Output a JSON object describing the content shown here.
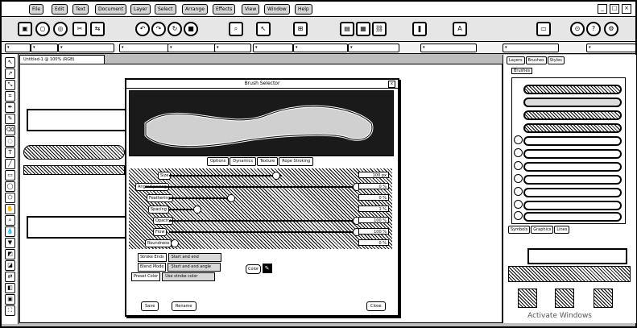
{
  "menubar": {
    "items": [
      "File",
      "Edit",
      "Text",
      "Document",
      "Layer",
      "Select",
      "Arrange",
      "Effects",
      "View",
      "Window",
      "Help"
    ]
  },
  "dialog": {
    "title": "Brush Selector",
    "close": "x",
    "tabs": [
      "Options",
      "Dynamics",
      "Texture",
      "Rope Stroking"
    ],
    "rows": [
      {
        "label": "Size",
        "value": "100 px",
        "pct": 0.52
      },
      {
        "label": "Angle/Spacing",
        "value": "0 %",
        "pct": 0.97
      },
      {
        "label": "Feathering",
        "value": "0 %",
        "pct": 0.38
      },
      {
        "label": "Spacing",
        "value": "1 %",
        "pct": 0.12
      },
      {
        "label": "Opacity",
        "value": "100 %",
        "pct": 0.97
      },
      {
        "label": "Flow",
        "value": "100 %",
        "pct": 0.97
      },
      {
        "label": "Roundness",
        "value": "0 %",
        "pct": 0.0
      }
    ],
    "options": [
      {
        "label": "Stroke Ends",
        "value": "Start and end"
      },
      {
        "label": "Blend Mode",
        "value": "Start and end angle"
      },
      {
        "label": "Preset Color",
        "value": "Use stroke color"
      }
    ],
    "color_label": "Color",
    "buttons": {
      "save": "Save",
      "rename": "Rename",
      "close": "Close"
    }
  },
  "rpanel": {
    "tabs": [
      "Layers",
      "Brushes",
      "Styles"
    ],
    "list_label": "Brushes",
    "bottom_tabs": [
      "Symbols",
      "Graphics",
      "Lines"
    ],
    "watermark": "Activate Windows"
  },
  "doc_tab": "Untitled-1 @ 100% (RGB)"
}
